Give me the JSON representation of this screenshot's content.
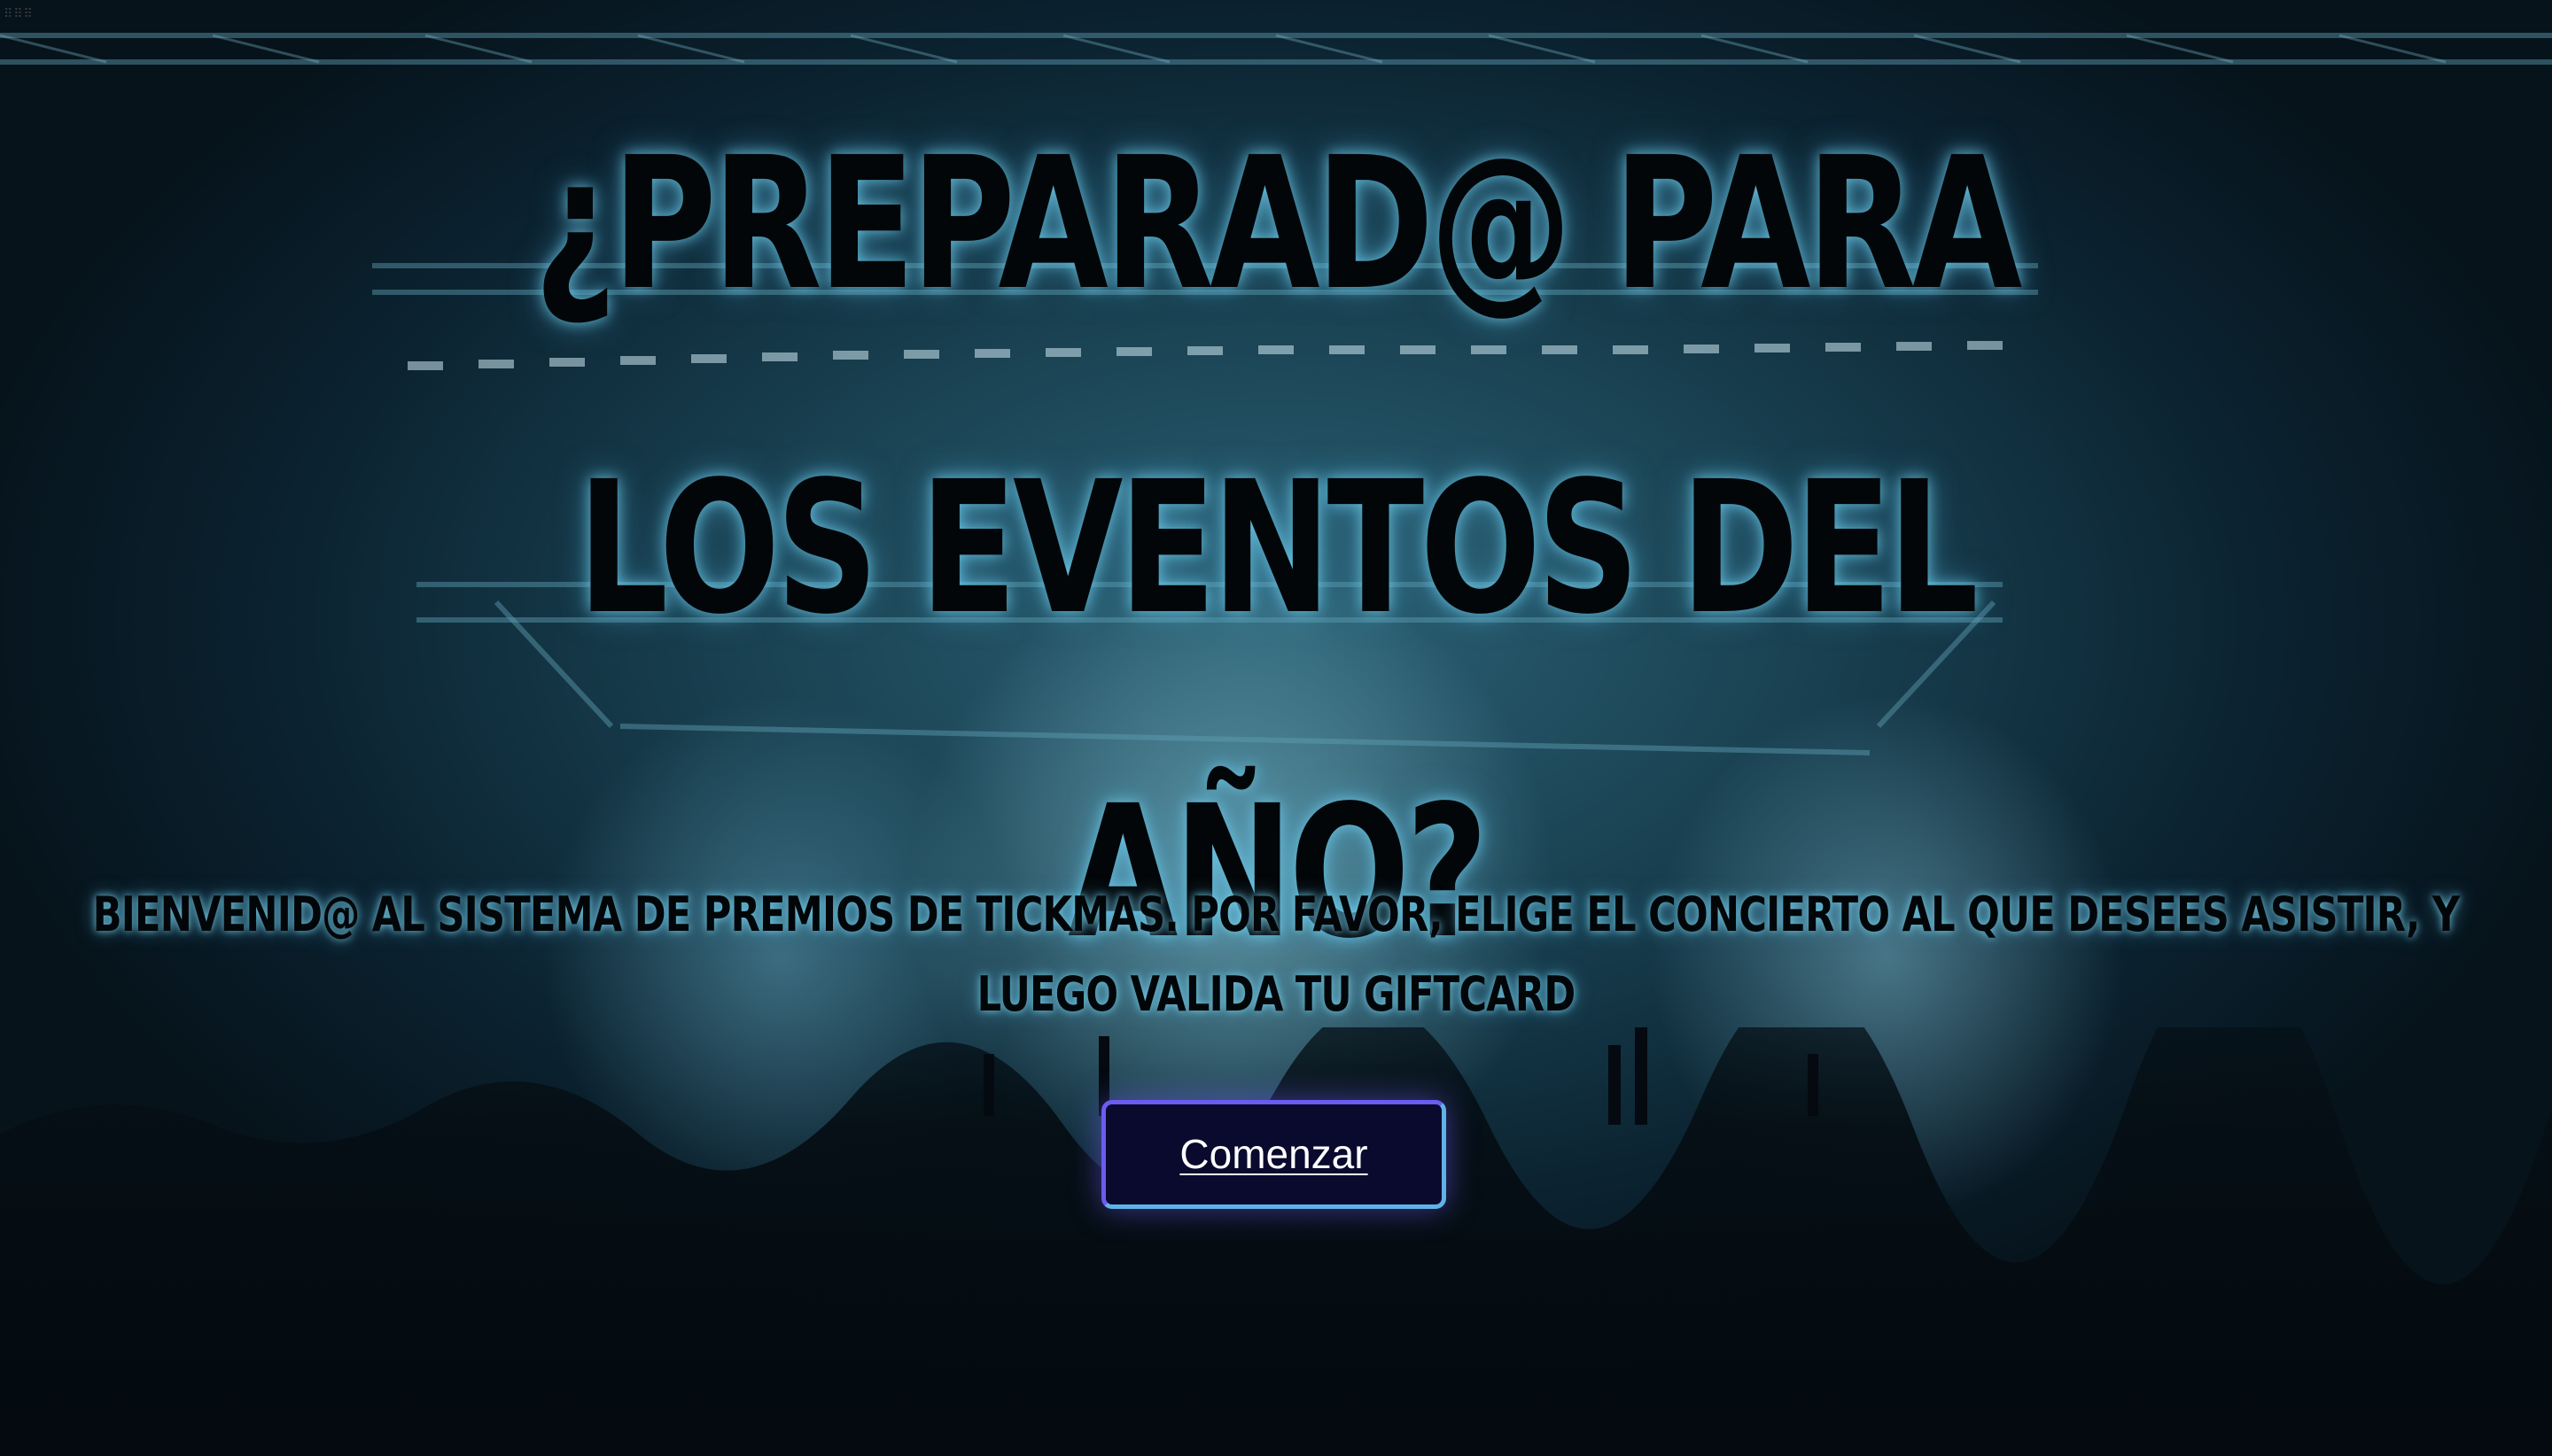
{
  "hero": {
    "title": "¿PREPARAD@ PARA LOS EVENTOS DEL AÑO?",
    "subtitle": "BIENVENID@ AL SISTEMA DE PREMIOS DE TICKMAS. POR FAVOR, ELIGE EL CONCIERTO AL QUE DESEES ASISTIR, Y LUEGO VALIDA TU GIFTCARD",
    "cta_label": "Comenzar"
  },
  "background": {
    "description_icon": "concert-stage-background",
    "tint": "#1f5366"
  },
  "colors": {
    "title_text": "#030608",
    "title_glow": "#6ecdeb",
    "button_bg": "#0a0a2e",
    "button_border_start": "#6a5cf0",
    "button_border_end": "#5fb2e8",
    "button_text": "#ffffff"
  }
}
